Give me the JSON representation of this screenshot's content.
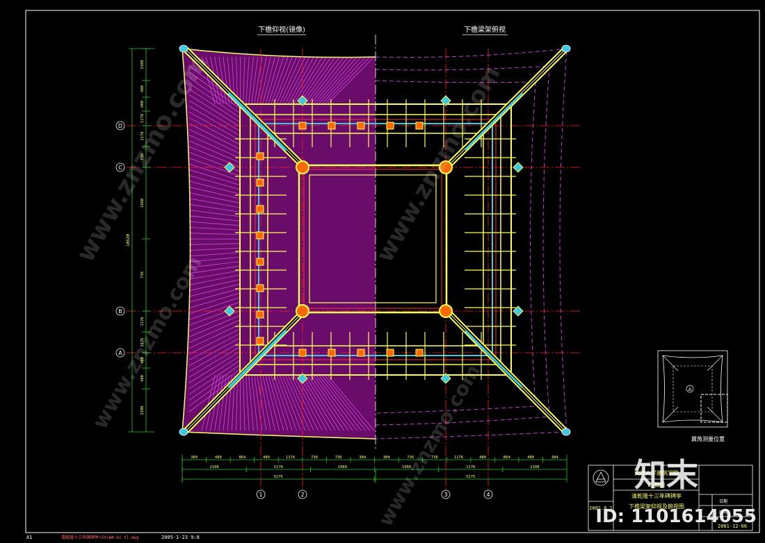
{
  "titles": {
    "left_view": "下檐仰视(镜像)",
    "right_view": "下檐梁架俯视"
  },
  "axes": {
    "rows": [
      "D",
      "C",
      "B",
      "A"
    ],
    "cols": [
      "1",
      "2",
      "3",
      "4"
    ]
  },
  "dimensions": {
    "left": [
      "2108",
      "480",
      "480",
      "1176",
      "1176",
      "736",
      "1960",
      "736",
      "1176",
      "1176",
      "480",
      "480",
      "2108"
    ],
    "left_total": "10530",
    "bottom_row1": [
      "384",
      "480",
      "864",
      "480",
      "1176",
      "736",
      "736",
      "384",
      "384",
      "736",
      "736",
      "1176",
      "480",
      "864",
      "480",
      "384"
    ],
    "bottom_row2": [
      "2108",
      "1176",
      "1960",
      "1960",
      "1176",
      "2108"
    ],
    "bottom_row3": [
      "5275",
      "5275"
    ]
  },
  "inset": {
    "caption": "翼角测量位置",
    "marker": "A"
  },
  "title_block": {
    "school": "天津大学建筑学院",
    "project": "颐和园",
    "drawing_title_1": "清乾隆十三年碑碑亭",
    "drawing_title_2": "下檐梁架仰视及俯视图",
    "code_left": "2001.8.1",
    "code_right": "2001-12-06",
    "right_label_1": "日期",
    "right_label_2": "图号"
  },
  "footer": {
    "sheet": "A1",
    "file": "清乾隆十三年碑碑亭(50)##-b1 tl.dwg",
    "date": "2005-1-23 9:8"
  },
  "watermark": {
    "brand": "知末",
    "site": "www.znzmo.com",
    "id": "ID: 1101614055"
  }
}
